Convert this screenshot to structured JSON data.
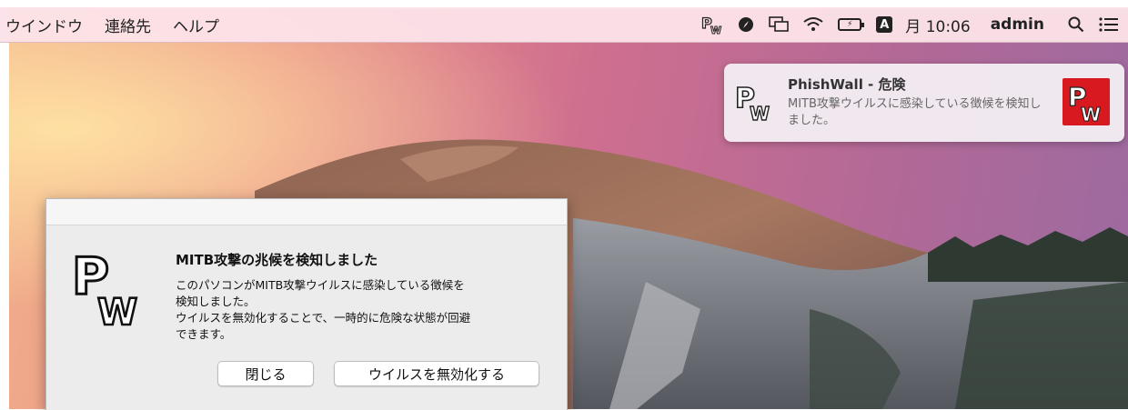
{
  "menubar": {
    "menus": [
      "ウインドウ",
      "連絡先",
      "ヘルプ"
    ],
    "clock": "月 10:06",
    "user": "admin",
    "input_source": "A",
    "battery_label": "⚡",
    "icons": [
      "phishwall-icon",
      "compass-icon",
      "display-mirror-icon",
      "wifi-icon",
      "battery-icon",
      "input-source-icon",
      "spotlight-search-icon",
      "notification-center-icon"
    ]
  },
  "notification": {
    "title": "PhishWall - 危険",
    "body": "MITB攻撃ウイルスに感染している徴候を検知しました。"
  },
  "dialog": {
    "headline": "MITB攻撃の兆候を検知しました",
    "line1": "このパソコンがMITB攻撃ウイルスに感染している徴候を",
    "line2": "検知しました。",
    "line3": "ウイルスを無効化することで、一時的に危険な状態が回避",
    "line4": "できます。",
    "close_label": "閉じる",
    "disable_label": "ウイルスを無効化する"
  },
  "colors": {
    "menubar_bg": "#fce2e8",
    "brand_red": "#d8191f",
    "dialog_bg": "#ececec"
  }
}
